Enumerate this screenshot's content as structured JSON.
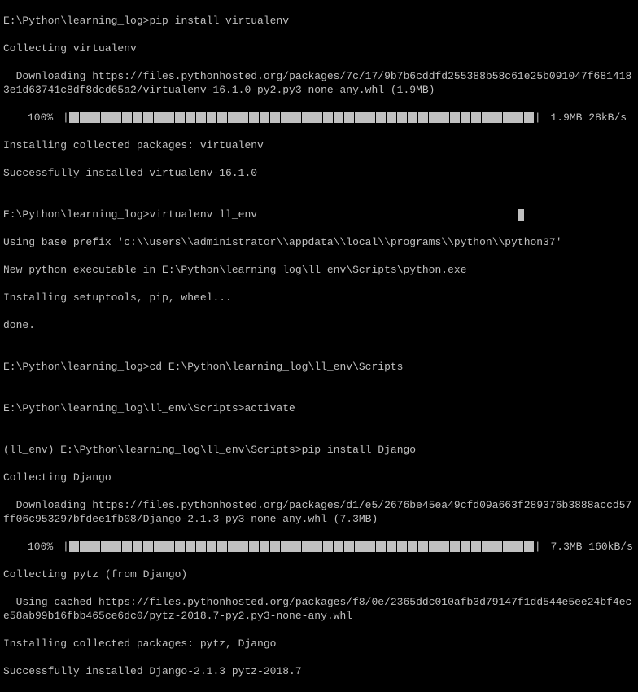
{
  "lines": {
    "l1_prompt": "E:\\Python\\learning_log>",
    "l1_cmd": "pip install virtualenv",
    "l2": "Collecting virtualenv",
    "l3": "  Downloading https://files.pythonhosted.org/packages/7c/17/9b7b6cddfd255388b58c61e25b091047f6814183e1d63741c8df8dcd65a2/virtualenv-16.1.0-py2.py3-none-any.whl (1.9MB)",
    "l4_percent": "100%",
    "l4_stats": "1.9MB 28kB/s",
    "l5": "Installing collected packages: virtualenv",
    "l6": "Successfully installed virtualenv-16.1.0",
    "l7": "",
    "l8_prompt": "E:\\Python\\learning_log>",
    "l8_cmd": "virtualenv ll_env",
    "l9": "Using base prefix 'c:\\\\users\\\\administrator\\\\appdata\\\\local\\\\programs\\\\python\\\\python37'",
    "l10": "New python executable in E:\\Python\\learning_log\\ll_env\\Scripts\\python.exe",
    "l11": "Installing setuptools, pip, wheel...",
    "l12": "done.",
    "l13": "",
    "l14_prompt": "E:\\Python\\learning_log>",
    "l14_cmd": "cd E:\\Python\\learning_log\\ll_env\\Scripts",
    "l15": "",
    "l16_prompt": "E:\\Python\\learning_log\\ll_env\\Scripts>",
    "l16_cmd": "activate",
    "l17": "",
    "l18_prompt": "(ll_env) E:\\Python\\learning_log\\ll_env\\Scripts>",
    "l18_cmd": "pip install Django",
    "l19": "Collecting Django",
    "l20": "  Downloading https://files.pythonhosted.org/packages/d1/e5/2676be45ea49cfd09a663f289376b3888accd57ff06c953297bfdee1fb08/Django-2.1.3-py3-none-any.whl (7.3MB)",
    "l21_percent": "100%",
    "l21_stats": "7.3MB 160kB/s",
    "l22": "Collecting pytz (from Django)",
    "l23": "  Using cached https://files.pythonhosted.org/packages/f8/0e/2365ddc010afb3d79147f1dd544e5ee24bf4ece58ab99b16fbb465ce6dc0/pytz-2018.7-py2.py3-none-any.whl",
    "l24": "Installing collected packages: pytz, Django",
    "l25": "Successfully installed Django-2.1.3 pytz-2018.7"
  },
  "progress": {
    "blocks1": 44,
    "blocks2": 44
  }
}
